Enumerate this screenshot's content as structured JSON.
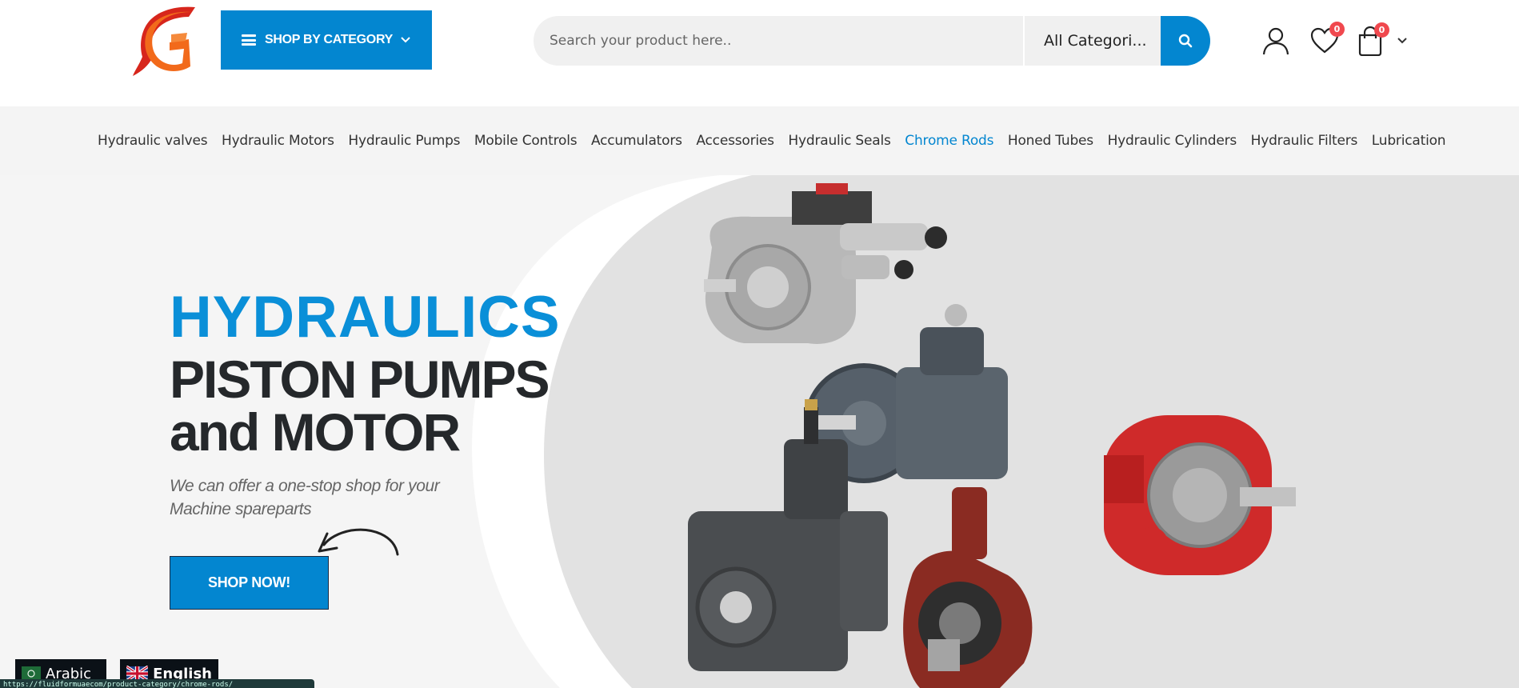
{
  "header": {
    "shop_by_category_label": "SHOP BY CATEGORY",
    "search_placeholder": "Search your product here..",
    "search_category": "All Categori...",
    "wishlist_count": "0",
    "cart_count": "0"
  },
  "nav": {
    "items": [
      {
        "label": "Hydraulic valves"
      },
      {
        "label": "Hydraulic Motors"
      },
      {
        "label": "Hydraulic Pumps"
      },
      {
        "label": "Mobile Controls"
      },
      {
        "label": "Accumulators"
      },
      {
        "label": "Accessories"
      },
      {
        "label": "Hydraulic Seals"
      },
      {
        "label": "Chrome Rods"
      },
      {
        "label": "Honed Tubes"
      },
      {
        "label": "Hydraulic Cylinders"
      },
      {
        "label": "Hydraulic Filters"
      },
      {
        "label": "Lubrication"
      }
    ],
    "active_index": 7
  },
  "hero": {
    "title_blue": "HYDRAULICS",
    "title_line1": "PISTON PUMPS",
    "title_line2": "and MOTOR",
    "subtitle_line1": "We can offer a one-stop shop for your",
    "subtitle_line2": "Machine spareparts",
    "cta_label": "SHOP NOW!"
  },
  "language": {
    "arabic": "Arabic",
    "english": "English"
  },
  "status_url": "https://fluidformuaecom/product-category/chrome-rods/",
  "colors": {
    "accent": "#0386d0",
    "dark_text": "#25282b",
    "badge": "#f0484e",
    "logo_orange": "#f26a1b",
    "logo_red": "#d7261c"
  }
}
